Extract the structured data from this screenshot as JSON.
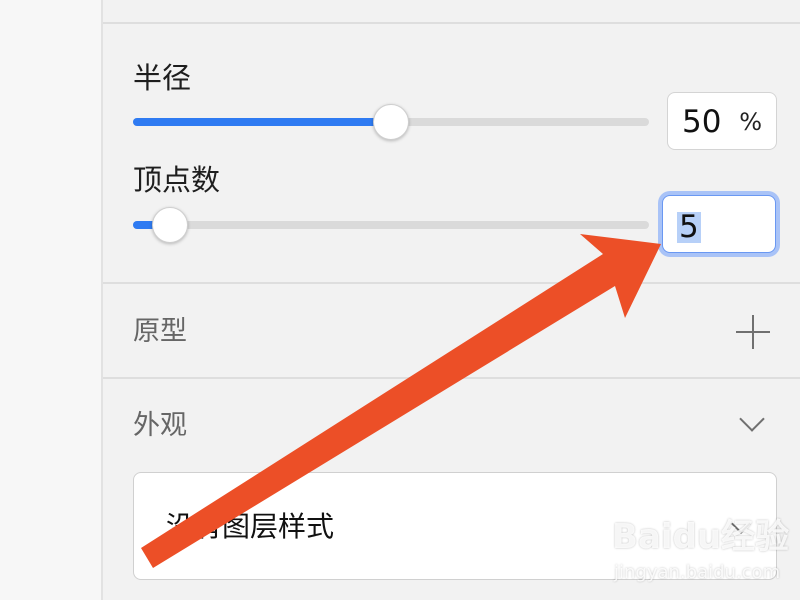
{
  "radius": {
    "label": "半径",
    "value": "50",
    "unit": "%",
    "slider_fraction": 0.5
  },
  "points": {
    "label": "顶点数",
    "value": "5",
    "slider_fraction": 0.05
  },
  "prototype": {
    "title": "原型",
    "add_icon": "plus-icon"
  },
  "appearance": {
    "title": "外观",
    "collapse_icon": "chevron-down-icon",
    "layer_style": {
      "value": "没有图层样式",
      "icon": "chevron-down-icon"
    }
  },
  "watermark": {
    "main": "Baidu经验",
    "sub": "jingyan.baidu.com"
  },
  "colors": {
    "accent": "#2f7bf2",
    "annotation_arrow": "#ec4f27",
    "focus_ring": "#a9c3f7"
  }
}
